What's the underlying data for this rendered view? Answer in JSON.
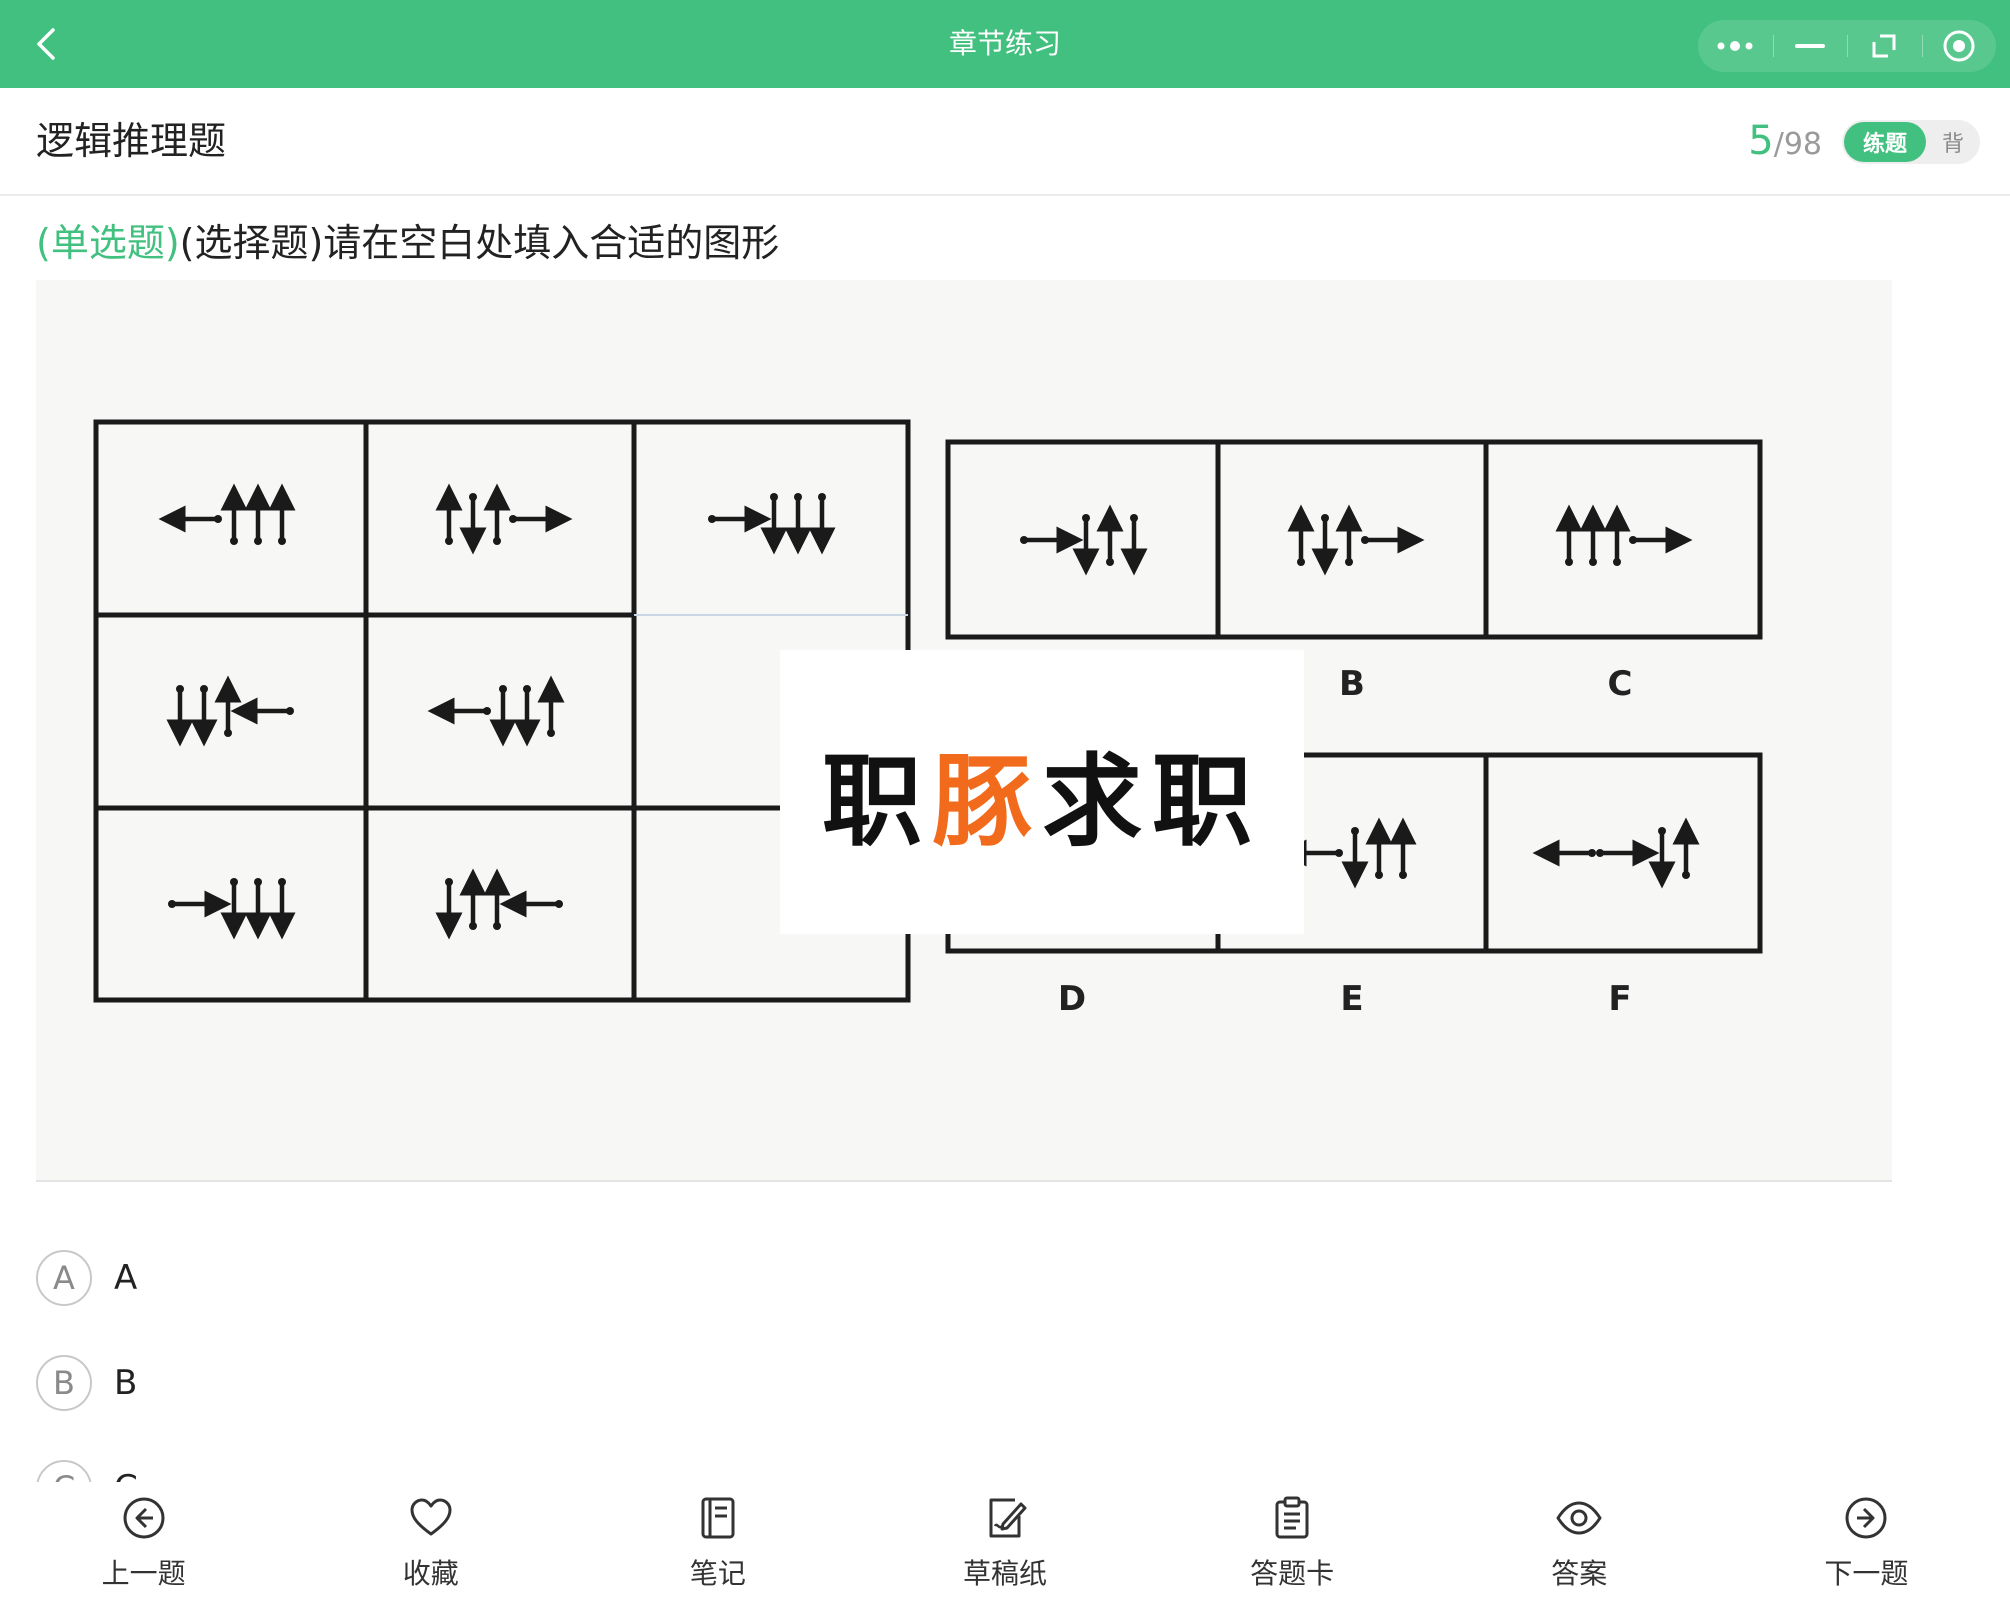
{
  "topbar": {
    "title": "章节练习",
    "bg_color": "#41c07f",
    "icons": [
      "chevron-left-icon",
      "more-dots-icon",
      "minimize-icon",
      "restore-window-icon",
      "close-target-icon"
    ]
  },
  "header": {
    "section_title": "逻辑推理题",
    "progress_current": "5",
    "progress_total": "/98",
    "mode_practice": "练题",
    "mode_recite": "背"
  },
  "question": {
    "type_label": "(单选题)",
    "text": "(选择题)请在空白处填入合适的图形"
  },
  "figure": {
    "watermark_part1": "职",
    "watermark_accent": "豚",
    "watermark_part2": "求职",
    "accent_color": "#f26a1b",
    "grid_cells": [
      {
        "row": 1,
        "col": 1,
        "symbols": "←↑↑↑"
      },
      {
        "row": 1,
        "col": 2,
        "symbols": "↑↓↑→"
      },
      {
        "row": 1,
        "col": 3,
        "symbols": "→↓↓↓"
      },
      {
        "row": 2,
        "col": 1,
        "symbols": "↓↓↑←"
      },
      {
        "row": 2,
        "col": 2,
        "symbols": "←↓↓↑"
      },
      {
        "row": 2,
        "col": 3,
        "symbols": ""
      },
      {
        "row": 3,
        "col": 1,
        "symbols": "→↓↓↓"
      },
      {
        "row": 3,
        "col": 2,
        "symbols": "↓↑↑←"
      },
      {
        "row": 3,
        "col": 3,
        "symbols": "?"
      }
    ],
    "choice_labels": [
      "B",
      "C",
      "D",
      "E",
      "F"
    ],
    "choice_symbols": {
      "A": "→↓↑↓",
      "B": "↑↓↑→",
      "C": "↑↑↑→",
      "E": "←↓↑↑",
      "F": "←→↓↑"
    }
  },
  "options": [
    {
      "letter": "A",
      "text": "A"
    },
    {
      "letter": "B",
      "text": "B"
    },
    {
      "letter": "C",
      "text": "C"
    }
  ],
  "bottom_nav": [
    {
      "label": "上一题",
      "icon": "arrow-left-circle-icon"
    },
    {
      "label": "收藏",
      "icon": "heart-icon"
    },
    {
      "label": "笔记",
      "icon": "notebook-icon"
    },
    {
      "label": "草稿纸",
      "icon": "scratch-paper-icon"
    },
    {
      "label": "答题卡",
      "icon": "answer-sheet-icon"
    },
    {
      "label": "答案",
      "icon": "eye-icon"
    },
    {
      "label": "下一题",
      "icon": "arrow-right-circle-icon"
    }
  ]
}
